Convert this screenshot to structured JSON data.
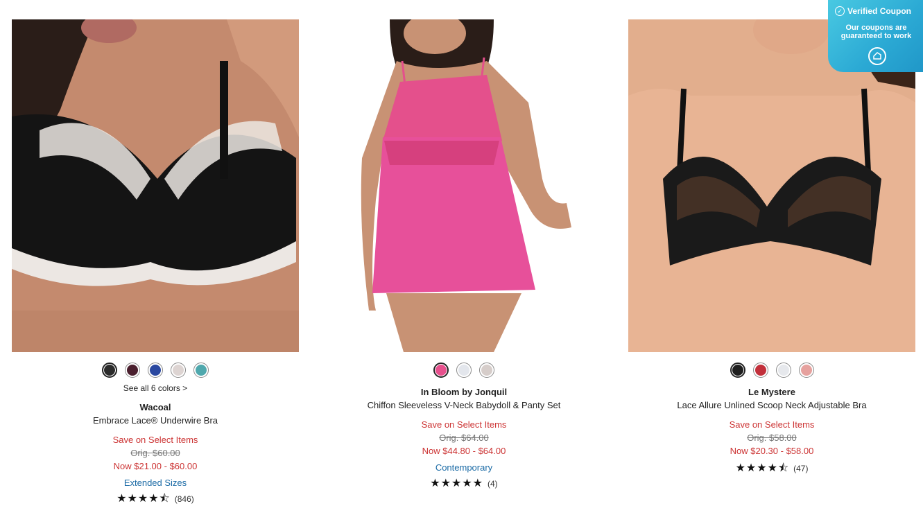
{
  "products": [
    {
      "image_alt": "Wacoal Embrace Lace Underwire Bra",
      "swatches": [
        "#2b2b2b",
        "#4a1f2e",
        "#2a48a0",
        "#ddd4d2",
        "#4fa8ad"
      ],
      "selected_swatch": 0,
      "see_all": "See all 6 colors >",
      "brand": "Wacoal",
      "title": "Embrace Lace® Underwire Bra",
      "promo": "Save on Select Items",
      "orig": "Orig. $60.00",
      "now": "Now $21.00 - $60.00",
      "tag": "Extended Sizes",
      "stars": "★★★★⯪",
      "review_count": "(846)"
    },
    {
      "image_alt": "In Bloom by Jonquil Chiffon Sleeveless V-Neck Babydoll & Panty Set",
      "swatches": [
        "#e7508d",
        "#e3e6ec",
        "#d6cdca"
      ],
      "selected_swatch": 0,
      "brand": "In Bloom by Jonquil",
      "title": "Chiffon Sleeveless V-Neck Babydoll & Panty Set",
      "promo": "Save on Select Items",
      "orig": "Orig. $64.00",
      "now": "Now $44.80 - $64.00",
      "tag": "Contemporary",
      "stars": "★★★★★",
      "review_count": "(4)"
    },
    {
      "image_alt": "Le Mystere Lace Allure Unlined Scoop Neck Adjustable Bra",
      "swatches": [
        "#1e1e1e",
        "#c2303b",
        "#e6e8ec",
        "#e6a19e"
      ],
      "selected_swatch": 0,
      "brand": "Le Mystere",
      "title": "Lace Allure Unlined Scoop Neck Adjustable Bra",
      "promo": "Save on Select Items",
      "orig": "Orig. $58.00",
      "now": "Now $20.30 - $58.00",
      "stars": "★★★★⯪",
      "review_count": "(47)"
    }
  ],
  "coupon": {
    "title": "Verified Coupon",
    "text": "Our coupons are guaranteed to work"
  },
  "colors": {
    "sale_red": "#cc3333",
    "link_blue": "#1a6aa5",
    "coupon_cyan": "#2ba9d4"
  }
}
